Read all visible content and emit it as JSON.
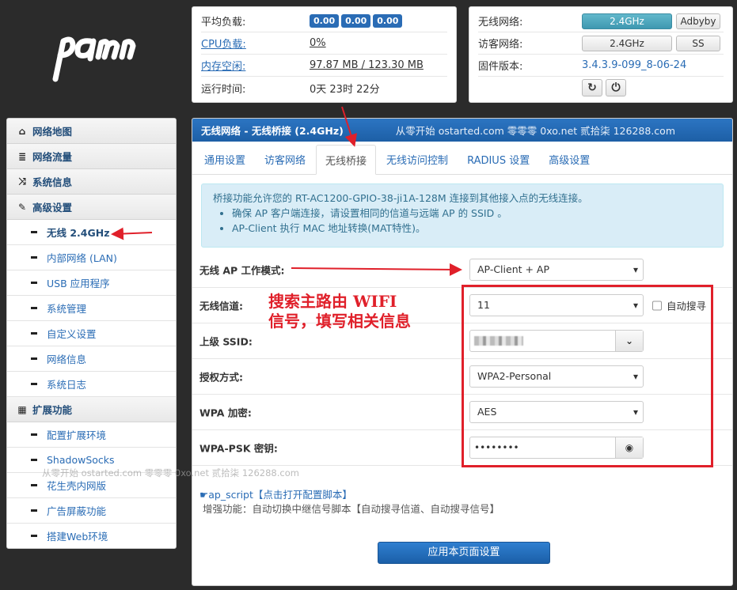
{
  "status": {
    "avg_load_label": "平均负载:",
    "avg_load_values": [
      "0.00",
      "0.00",
      "0.00"
    ],
    "cpu_label": "CPU负载:",
    "cpu_value": "0%",
    "mem_label": "内存空闲:",
    "mem_value": "97.87 MB / 123.30 MB",
    "uptime_label": "运行时间:",
    "uptime_value": "0天 23时 22分"
  },
  "network": {
    "wireless_label": "无线网络:",
    "wireless_btn": "2.4GHz",
    "wireless_btn2": "Adbyby",
    "guest_label": "访客网络:",
    "guest_btn": "2.4GHz",
    "guest_btn2": "SS",
    "firmware_label": "固件版本:",
    "firmware_value": "3.4.3.9-099_8-06-24",
    "refresh_icon": "refresh-icon",
    "power_icon": "power-icon"
  },
  "sidebar": {
    "groups": [
      {
        "label": "网络地图",
        "icon": "home-icon"
      },
      {
        "label": "网络流量",
        "icon": "traffic-icon"
      },
      {
        "label": "系统信息",
        "icon": "shuffle-icon"
      },
      {
        "label": "高级设置",
        "icon": "wrench-icon"
      }
    ],
    "advanced_items": [
      "无线 2.4GHz",
      "内部网络 (LAN)",
      "USB 应用程序",
      "系统管理",
      "自定义设置",
      "网络信息",
      "系统日志"
    ],
    "ext_group": {
      "label": "扩展功能",
      "icon": "grid-icon"
    },
    "ext_items": [
      "配置扩展环境",
      "ShadowSocks",
      "花生壳内网版",
      "广告屏蔽功能",
      "搭建Web环境"
    ]
  },
  "watermark": "从零开始 ostarted.com 零零零 0xo.net 贰拾柒 126288.com",
  "main": {
    "title": "无线网络 - 无线桥接 (2.4GHz)",
    "header_watermark": "从零开始 ostarted.com 零零零 0xo.net 贰拾柒 126288.com",
    "tabs": [
      "通用设置",
      "访客网络",
      "无线桥接",
      "无线访问控制",
      "RADIUS 设置",
      "高级设置"
    ],
    "info_line": "桥接功能允许您的 RT-AC1200-GPIO-38-ji1A-128M 连接到其他接入点的无线连接。",
    "info_bullets": [
      "确保 AP 客户端连接，请设置相同的信道与远端 AP 的 SSID 。",
      "AP-Client 执行 MAC 地址转换(MAT特性)。"
    ],
    "form": {
      "mode_label": "无线 AP 工作模式:",
      "mode_value": "AP-Client + AP",
      "channel_label": "无线信道:",
      "channel_value": "11",
      "auto_scan_label": "自动搜寻",
      "ssid_label": "上级 SSID:",
      "auth_label": "授权方式:",
      "auth_value": "WPA2-Personal",
      "wpa_label": "WPA 加密:",
      "wpa_value": "AES",
      "psk_label": "WPA-PSK 密钥:",
      "psk_value": "••••••••"
    },
    "script_link": "ap_script【点击打开配置脚本】",
    "script_note": "增强功能：自动切换中继信号脚本【自动搜寻信道、自动搜寻信号】",
    "apply_button": "应用本页面设置"
  },
  "annotation": {
    "text": "搜索主路由 WIFI\n信号，填写相关信息",
    "color": "#e0202a"
  }
}
